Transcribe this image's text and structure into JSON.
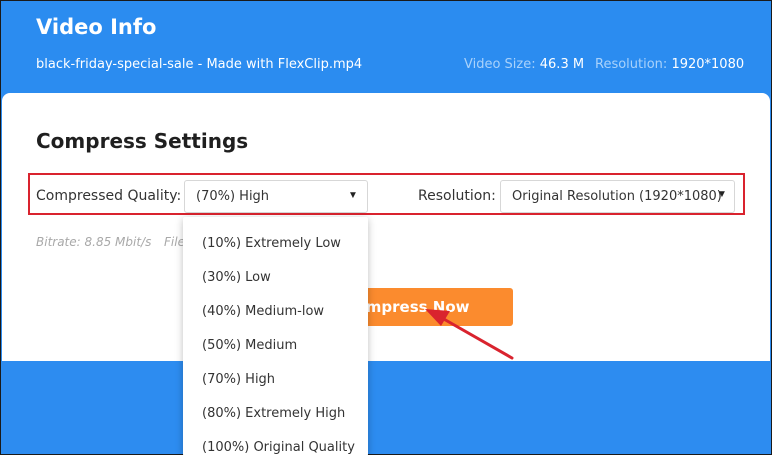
{
  "header": {
    "title": "Video Info",
    "file_name": "black-friday-special-sale - Made with FlexClip.mp4",
    "video_size_label": "Video Size:",
    "video_size_value": "46.3 M",
    "resolution_label": "Resolution:",
    "resolution_value": "1920*1080"
  },
  "settings": {
    "title": "Compress Settings",
    "quality_label": "Compressed Quality:",
    "quality_value": "(70%) High",
    "resolution_label": "Resolution:",
    "resolution_value": "Original Resolution (1920*1080)",
    "bitrate": "Bitrate: 8.85 Mbit/s",
    "file_hint": "File",
    "compress_button": "Compress Now"
  },
  "quality_options": [
    "(10%) Extremely Low",
    "(30%) Low",
    "(40%) Medium-low",
    "(50%) Medium",
    "(70%) High",
    "(80%) Extremely High",
    "(100%) Original Quality"
  ],
  "colors": {
    "header_blue": "#2b8cf0",
    "accent_orange": "#fb8b2e",
    "highlight_red": "#d9232e"
  },
  "icons": {
    "caret": "caret-down-icon",
    "annotation": "red-arrow-annotation"
  }
}
